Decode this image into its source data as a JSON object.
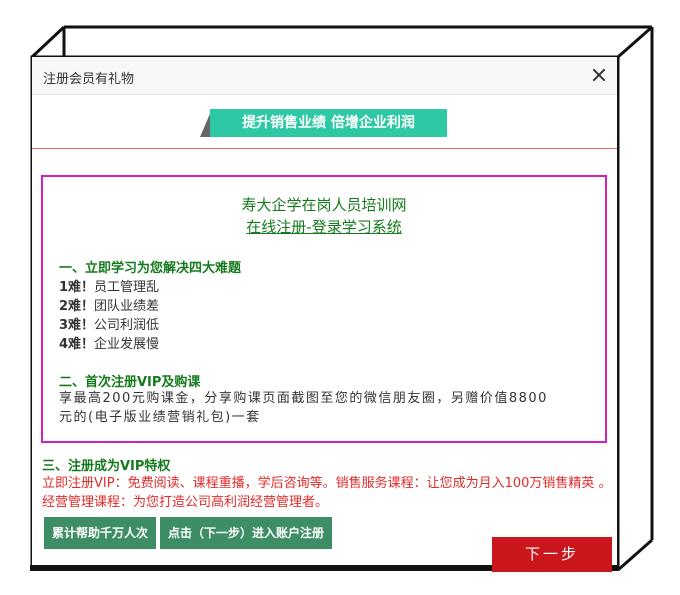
{
  "dialog": {
    "title": "注册会员有礼物",
    "close_icon": "close-icon"
  },
  "banner": {
    "text": "提升销售业绩 倍增企业利润",
    "color": "#2ec9a4"
  },
  "promo": {
    "title": "寿大企学在岗人员培训网",
    "link": "在线注册-登录学习系统",
    "section1": {
      "heading": "一、立即学习为您解决四大难题",
      "items": [
        {
          "num": "1难！",
          "text": "员工管理乱"
        },
        {
          "num": "2难！",
          "text": "团队业绩差"
        },
        {
          "num": "3难！",
          "text": "公司利润低"
        },
        {
          "num": "4难！",
          "text": "企业发展慢"
        }
      ]
    },
    "section2": {
      "heading": "二、首次注册VIP及购课",
      "desc": "享最高200元购课金，分享购课页面截图至您的微信朋友圈，另赠价值8800元的(电子版业绩营销礼包)一套"
    }
  },
  "vip": {
    "heading": "三、注册成为VIP特权",
    "text": "立即注册VIP：免费阅读、课程重播，学后咨询等。销售服务课程：让您成为月入100万销售精英 。经营管理课程：为您打造公司高利润经营管理者。"
  },
  "buttons": {
    "helped": "累计帮助千万人次",
    "register": "点击（下一步）进入账户注册",
    "next": "下一步"
  },
  "colors": {
    "accent_green": "#157a1d",
    "button_green": "#3e8e65",
    "alert_red": "#e42a2a",
    "next_red": "#cc161d",
    "promo_border": "#d21fbe"
  }
}
